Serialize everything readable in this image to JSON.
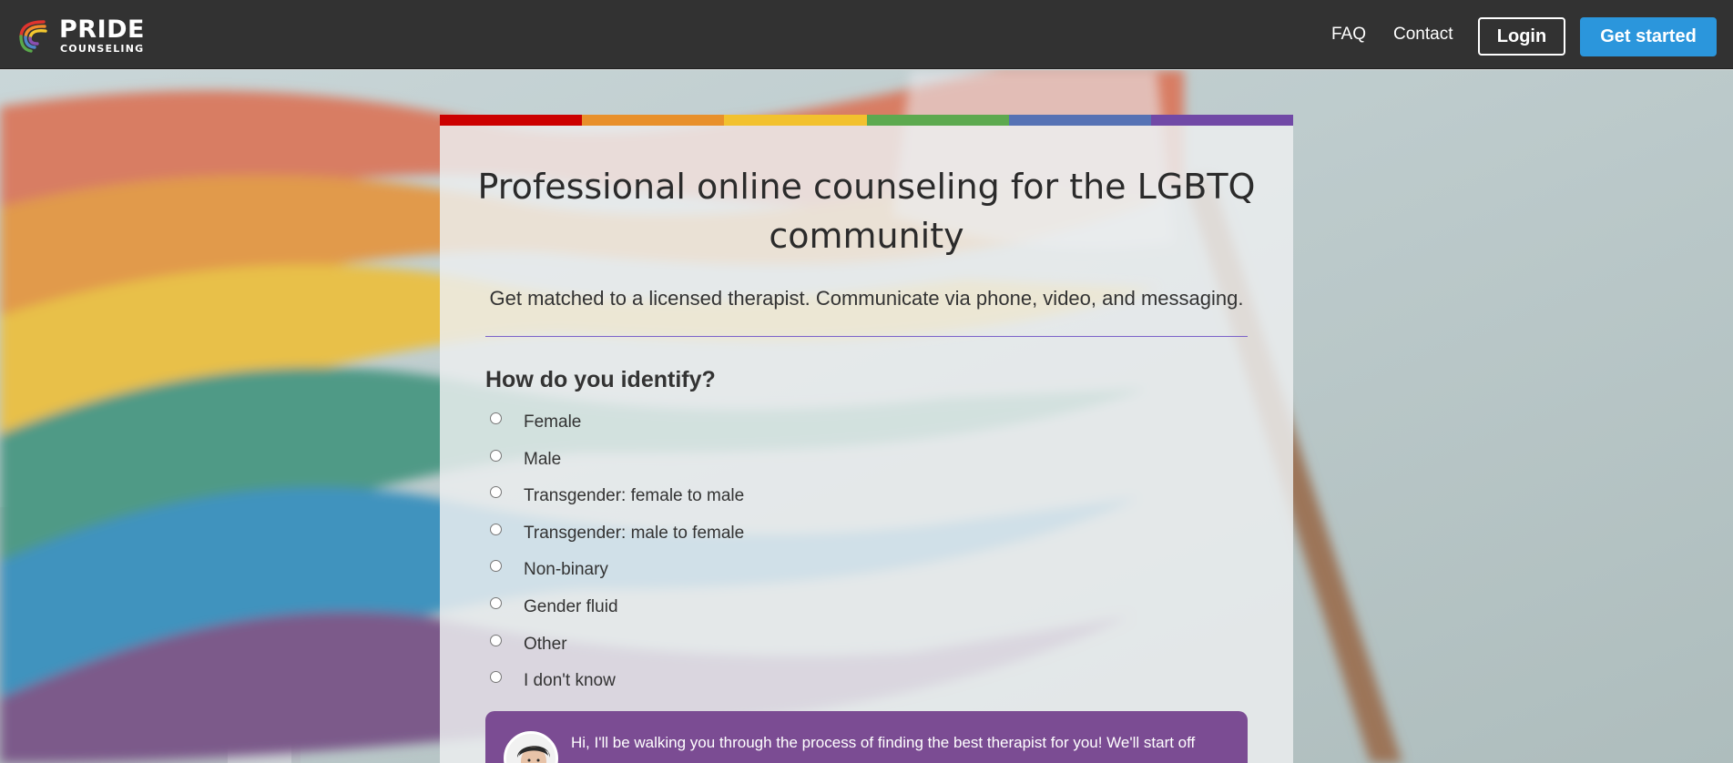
{
  "header": {
    "logo_word1": "PRIDE",
    "logo_word2": "COUNSELING",
    "nav_faq": "FAQ",
    "nav_contact": "Contact",
    "login_label": "Login",
    "get_started_label": "Get started"
  },
  "card": {
    "headline": "Professional online counseling for the LGBTQ community",
    "subline": "Get matched to a licensed therapist. Communicate via phone, video, and messaging.",
    "question": "How do you identify?",
    "options": [
      "Female",
      "Male",
      "Transgender: female to male",
      "Transgender: male to female",
      "Non-binary",
      "Gender fluid",
      "Other",
      "I don't know"
    ],
    "chat_message": "Hi, I'll be walking you through the process of finding the best therapist for you! We'll start off"
  },
  "colors": {
    "topbar": "#323232",
    "primary_button": "#2b96dc",
    "divider": "#7b62c9",
    "chat_bubble": "#7b4c93",
    "stripe": [
      "#cc0000",
      "#e8902b",
      "#f2c12e",
      "#5da94f",
      "#5672b4",
      "#7149a6"
    ]
  },
  "icons": {
    "logo": "rainbow-ribbon-logo-icon",
    "avatar": "counselor-avatar"
  }
}
